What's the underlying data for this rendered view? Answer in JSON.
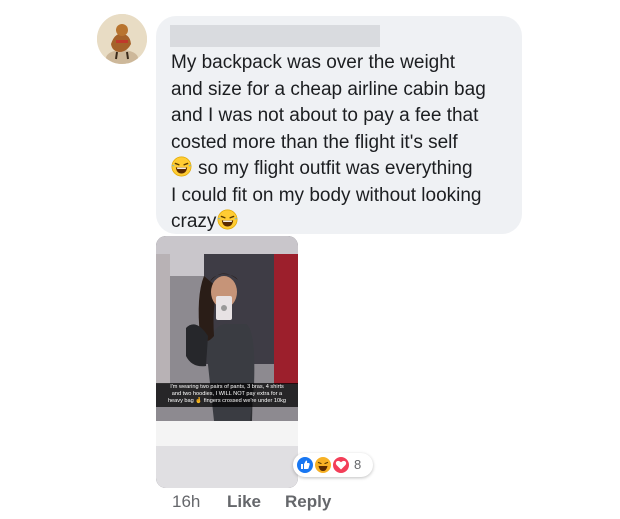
{
  "comment": {
    "lines": [
      "My backpack was over the weight",
      "and size for a cheap airline cabin bag",
      "and I was not about to pay a fee that",
      "costed more than the flight it's self",
      "so my flight outfit was everything",
      "I could fit on my body without looking",
      "crazy"
    ],
    "emoji": "laughing-tears-icon"
  },
  "photo": {
    "caption": "I'm wearing two pairs of pants, 3 bras, 4 shirts\nand two hoodies, I WILL NOT pay extra for a\nheavy bag 🤞 fingers crossed we're under 10kg"
  },
  "reactions": {
    "icons": [
      "like-icon",
      "haha-icon",
      "love-icon"
    ],
    "count": "8",
    "colors": {
      "like": "#1877f2",
      "haha": "#f7b125",
      "love": "#f33e58"
    }
  },
  "actions": {
    "time": "16h",
    "like": "Like",
    "reply": "Reply"
  }
}
